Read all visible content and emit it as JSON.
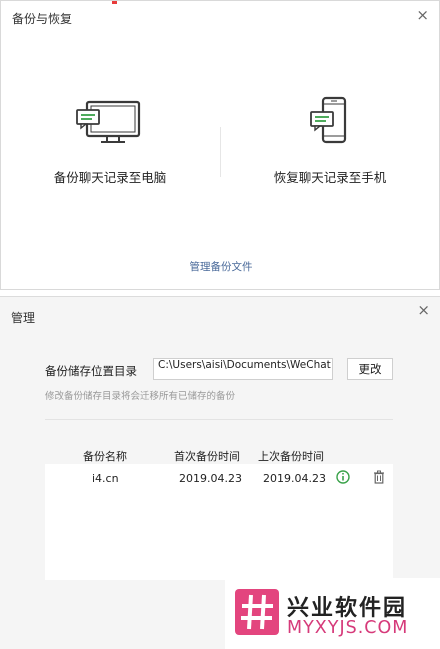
{
  "backup_window": {
    "title": "备份与恢复",
    "close_glyph": "×",
    "backup_to_pc": {
      "label": "备份聊天记录至电脑",
      "icon": "monitor-chat-icon"
    },
    "restore_to_phone": {
      "label": "恢复聊天记录至手机",
      "icon": "phone-chat-icon"
    },
    "manage_link": "管理备份文件"
  },
  "manage_window": {
    "title": "管理",
    "close_glyph": "×",
    "dir_label": "备份储存位置目录",
    "dir_value": "C:\\Users\\aisi\\Documents\\WeChat Files",
    "change_button": "更改",
    "hint": "修改备份储存目录将会迁移所有已储存的备份",
    "table": {
      "headers": [
        "备份名称",
        "首次备份时间",
        "上次备份时间"
      ],
      "rows": [
        {
          "name": "i4.cn",
          "first": "2019.04.23",
          "last": "2019.04.23"
        }
      ]
    }
  },
  "watermark": {
    "name": "兴业软件园",
    "url": "MYXYJS.COM"
  },
  "colors": {
    "accent_green": "#3aa24a",
    "link_blue": "#4a6a9a",
    "watermark_pink": "#d63a7a"
  }
}
